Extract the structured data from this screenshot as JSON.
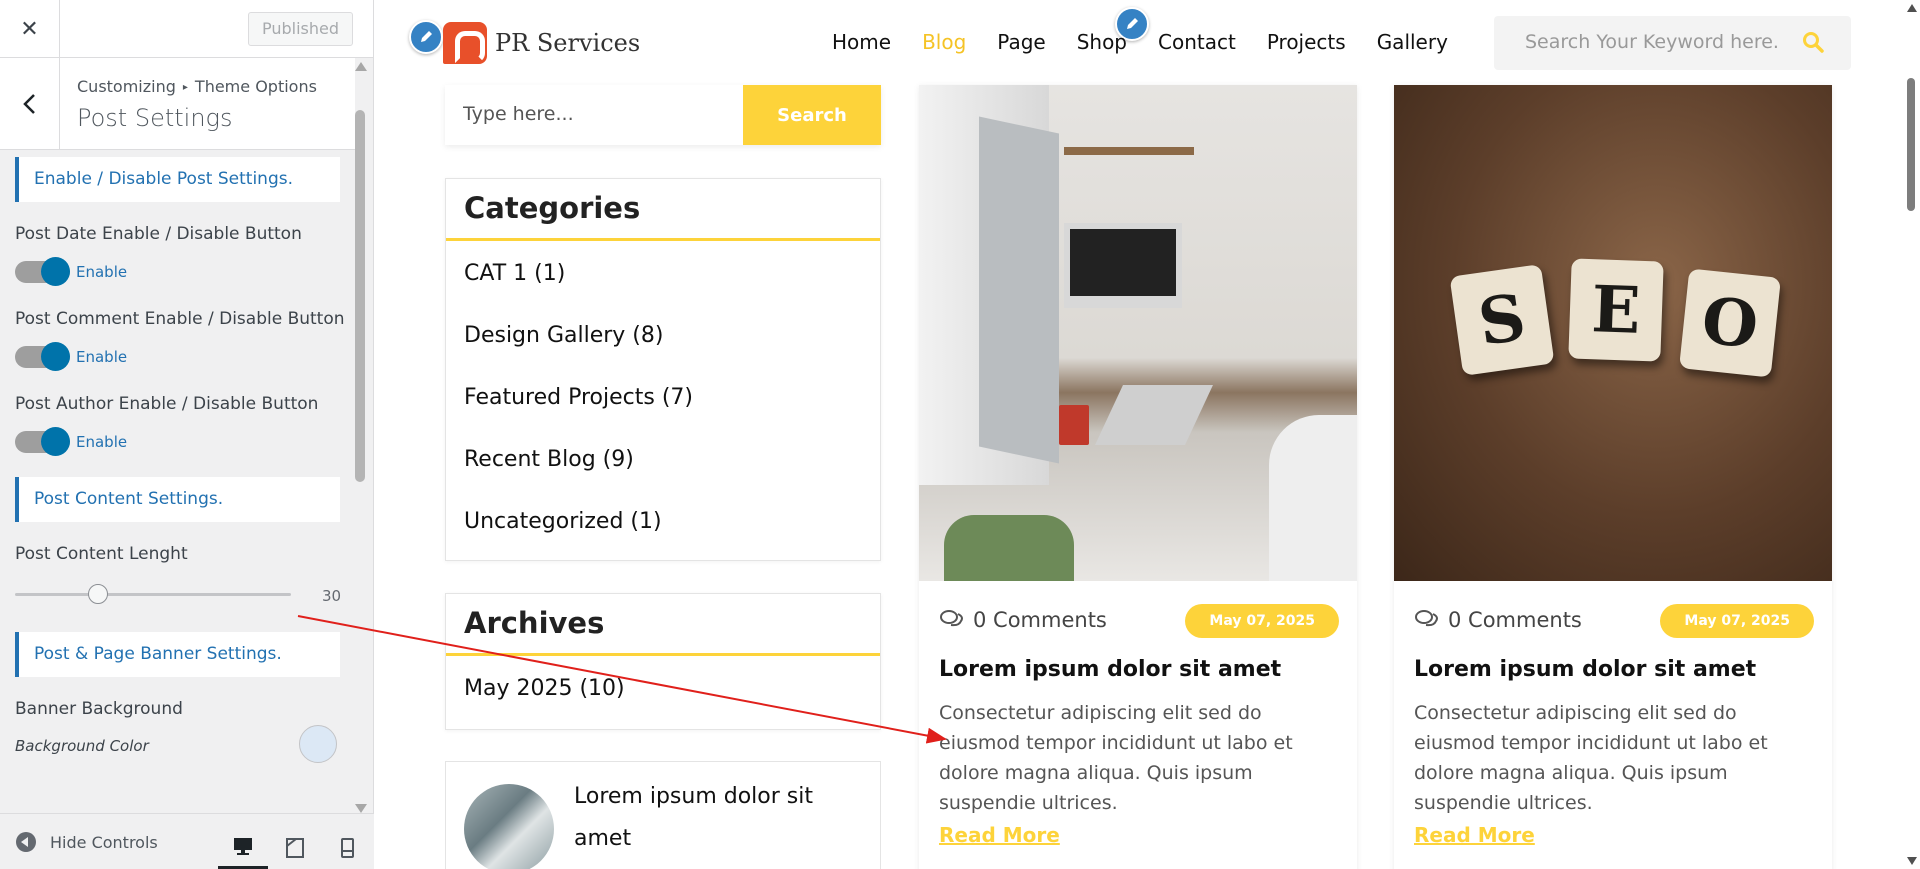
{
  "customizer": {
    "close_icon": "close-icon",
    "publish_label": "Published",
    "breadcrumb": [
      "Customizing",
      "Theme Options"
    ],
    "breadcrumb_sep": "▸",
    "panel_title": "Post Settings",
    "sections": {
      "enable_disable": "Enable / Disable Post Settings.",
      "content": "Post Content Settings.",
      "banner": "Post & Page Banner Settings."
    },
    "post_date_label": "Post Date Enable / Disable Button",
    "post_comment_label": "Post Comment Enable / Disable Button",
    "post_author_label": "Post Author Enable / Disable Button",
    "toggle_label": "Enable",
    "content_length_label": "Post Content Lenght",
    "content_length_value": "30",
    "content_length_fraction": 0.3,
    "banner_background_label": "Banner Background",
    "background_color_label": "Background Color",
    "hide_controls_label": "Hide Controls",
    "accent_color": "#2271b1"
  },
  "site": {
    "logo_text": "PR Services",
    "nav": [
      "Home",
      "Blog",
      "Page",
      "Shop",
      "Contact",
      "Projects",
      "Gallery"
    ],
    "active_nav": "Blog",
    "search_placeholder": "Search Your Keyword here.",
    "brand_color": "#fdd33a"
  },
  "sidebar": {
    "search_placeholder": "Type here...",
    "search_button": "Search",
    "categories_title": "Categories",
    "categories": [
      "CAT 1 (1)",
      "Design Gallery (8)",
      "Featured Projects (7)",
      "Recent Blog (9)",
      "Uncategorized (1)"
    ],
    "archives_title": "Archives",
    "archives": [
      "May 2025 (10)"
    ],
    "recent_post_title": "Lorem ipsum dolor sit amet"
  },
  "posts": [
    {
      "comments": "0 Comments",
      "date": "May  07, 2025",
      "title": "Lorem ipsum dolor sit amet",
      "excerpt": "Consectetur adipiscing elit sed do eiusmod tempor incididunt ut labo et dolore magna aliqua. Quis ipsum suspendie ultrices.",
      "read_more": "Read More",
      "image": "desk-workspace-image"
    },
    {
      "comments": "0 Comments",
      "date": "May  07, 2025",
      "title": "Lorem ipsum dolor sit amet",
      "excerpt": "Consectetur adipiscing elit sed do eiusmod tempor incididunt ut labo et dolore magna aliqua. Quis ipsum suspendie ultrices.",
      "read_more": "Read More",
      "image": "seo-tiles-image",
      "tiles": [
        "S",
        "E",
        "O"
      ]
    }
  ]
}
